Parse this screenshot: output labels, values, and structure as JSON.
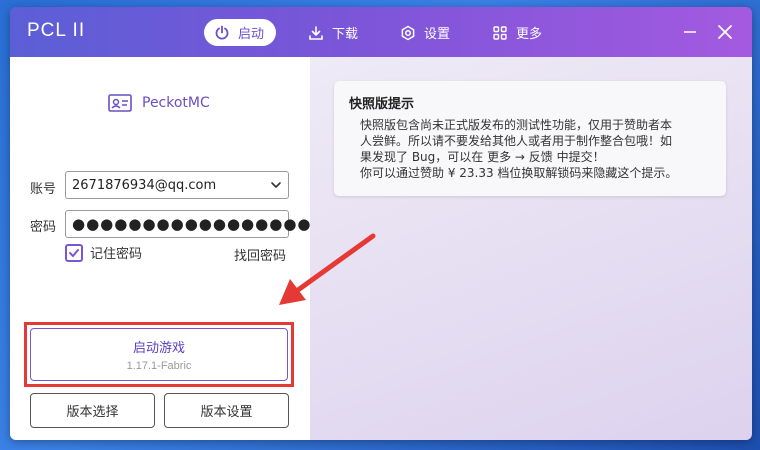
{
  "window": {
    "title": "PCL II"
  },
  "nav": [
    {
      "label": "启动",
      "icon": "power-icon",
      "active": true
    },
    {
      "label": "下载",
      "icon": "download-icon",
      "active": false
    },
    {
      "label": "设置",
      "icon": "settings-icon",
      "active": false
    },
    {
      "label": "更多",
      "icon": "grid-icon",
      "active": false
    }
  ],
  "user": {
    "name": "PeckotMC",
    "icon": "user-card-icon"
  },
  "login": {
    "account_label": "账号",
    "account_value": "2671876934@qq.com",
    "password_label": "密码",
    "password_value": "●●●●●●●●●●●●●●●●●●",
    "remember_label": "记住密码",
    "remember_checked": true,
    "forgot_label": "找回密码"
  },
  "launch": {
    "label": "启动游戏",
    "version": "1.17.1-Fabric"
  },
  "buttons": {
    "version_select": "版本选择",
    "version_settings": "版本设置"
  },
  "notice": {
    "title": "快照版提示",
    "line1": "快照版包含尚未正式版发布的测试性功能，仅用于赞助者本",
    "line2": "人尝鲜。所以请不要发给其他人或者用于制作整合包哦！如",
    "line3": "果发现了 Bug，可以在 更多 → 反馈 中提交！",
    "line4": "你可以通过赞助 ¥ 23.33 档位换取解锁码来隐藏这个提示。"
  },
  "colors": {
    "accent": "#7b55d8",
    "title_gradient_start": "#5b5fd6",
    "title_gradient_end": "#a35ae0",
    "annotation_red": "#e53935"
  }
}
